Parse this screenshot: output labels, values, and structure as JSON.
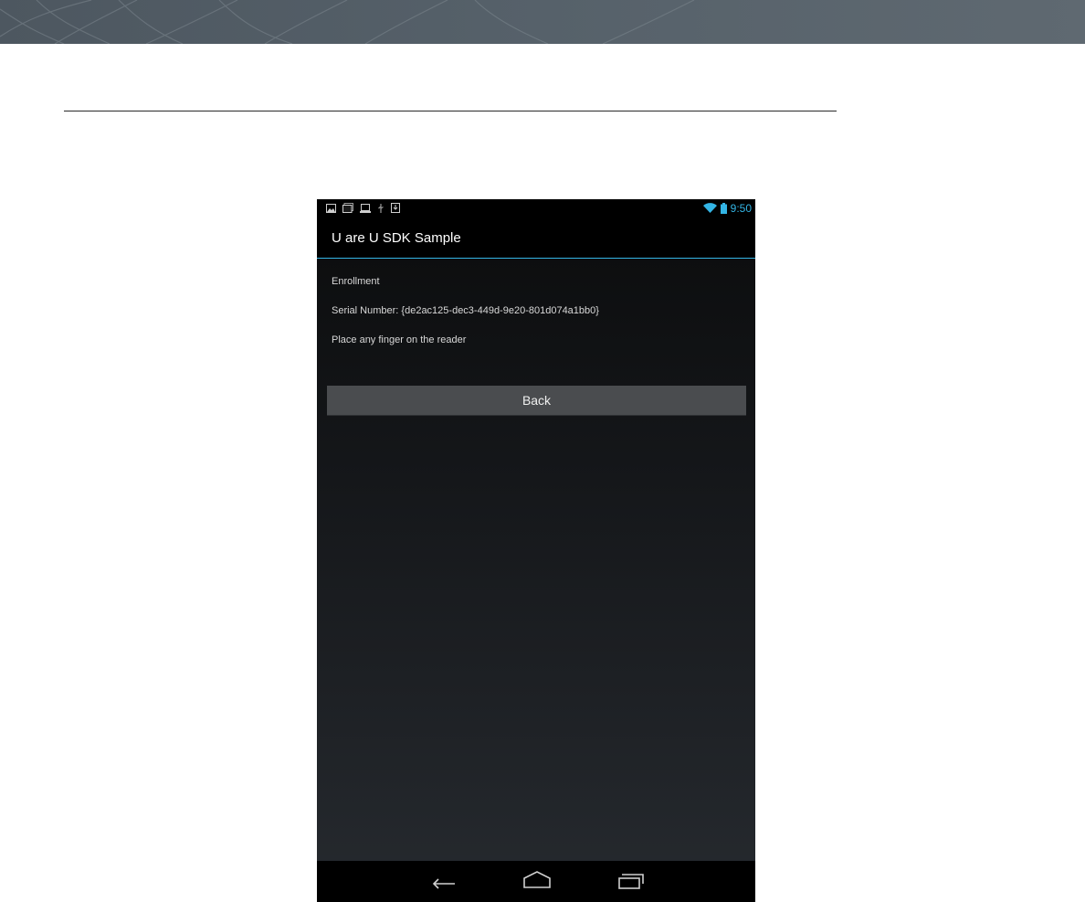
{
  "status_bar": {
    "time": "9:50",
    "left_icons": [
      "gallery-icon",
      "photos-icon",
      "laptop-icon",
      "usb-icon",
      "download-icon"
    ],
    "right_icons": [
      "wifi-icon",
      "battery-icon"
    ]
  },
  "app": {
    "title": "U are U SDK Sample"
  },
  "content": {
    "heading": "Enrollment",
    "serial": "Serial Number: {de2ac125-dec3-449d-9e20-801d074a1bb0}",
    "instruction": "Place any finger on the reader",
    "back_label": "Back"
  },
  "nav_bar": {
    "buttons": [
      "back-nav-icon",
      "home-icon",
      "recents-icon"
    ]
  },
  "colors": {
    "accent": "#33b5e5",
    "banner": "#56616a",
    "button": "#4a4c4f"
  }
}
